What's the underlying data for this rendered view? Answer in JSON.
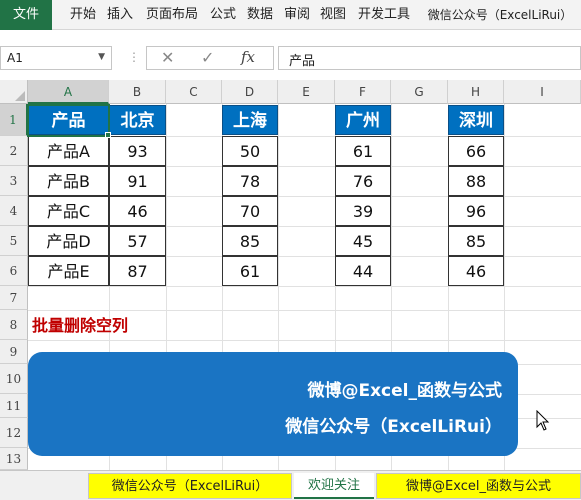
{
  "ribbon": {
    "tabs": [
      {
        "label": "文件"
      },
      {
        "label": "开始"
      },
      {
        "label": "插入"
      },
      {
        "label": "页面布局"
      },
      {
        "label": "公式"
      },
      {
        "label": "数据"
      },
      {
        "label": "审阅"
      },
      {
        "label": "视图"
      },
      {
        "label": "开发工具"
      },
      {
        "label": "微信公众号（ExcelLiRui）"
      }
    ]
  },
  "formula_bar": {
    "name_box": "A1",
    "fx": "fx",
    "value": "产品",
    "cancel_icon": "close-icon",
    "enter_icon": "check-icon"
  },
  "columns": [
    "A",
    "B",
    "C",
    "D",
    "E",
    "F",
    "G",
    "H",
    "I"
  ],
  "rows": [
    "1",
    "2",
    "3",
    "4",
    "5",
    "6",
    "7",
    "8",
    "9",
    "10",
    "11",
    "12",
    "13"
  ],
  "table": {
    "products": {
      "header": "产品",
      "values": [
        "产品A",
        "产品B",
        "产品C",
        "产品D",
        "产品E"
      ]
    },
    "beijing": {
      "header": "北京",
      "values": [
        "93",
        "91",
        "46",
        "57",
        "87"
      ]
    },
    "shanghai": {
      "header": "上海",
      "values": [
        "50",
        "78",
        "70",
        "85",
        "61"
      ]
    },
    "guangzhou": {
      "header": "广州",
      "values": [
        "61",
        "76",
        "39",
        "45",
        "44"
      ]
    },
    "shenzhen": {
      "header": "深圳",
      "values": [
        "66",
        "88",
        "96",
        "85",
        "46"
      ]
    }
  },
  "title_text": "批量删除空列",
  "banner": {
    "line1": "微博@Excel_函数与公式",
    "line2": "微信公众号（ExcelLiRui）"
  },
  "sheet_tabs": [
    {
      "label": "微信公众号（ExcelLiRui）"
    },
    {
      "label": "欢迎关注"
    },
    {
      "label": "微博@Excel_函数与公式"
    }
  ],
  "colors": {
    "header_blue": "#0070c0",
    "banner_blue": "#1a74c3",
    "title_red": "#c00000",
    "excel_green": "#217346",
    "tab_yellow": "#ffff00"
  }
}
